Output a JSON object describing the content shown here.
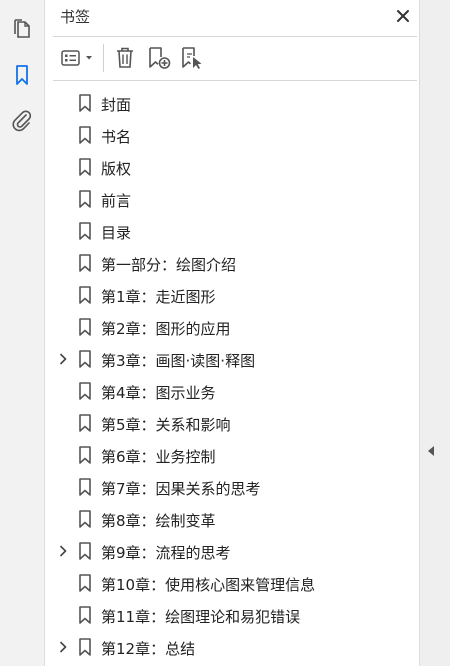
{
  "panel": {
    "title": "书签",
    "close_icon": "close-icon"
  },
  "rail": {
    "items": [
      {
        "name": "pages-icon",
        "active": false
      },
      {
        "name": "bookmark-icon",
        "active": true
      },
      {
        "name": "paperclip-icon",
        "active": false
      }
    ]
  },
  "toolbar": {
    "items": [
      "options-menu-icon",
      "delete-bookmark-icon",
      "new-bookmark-icon",
      "bookmark-from-selection-icon"
    ]
  },
  "colors": {
    "accent": "#1473e6",
    "icon": "#555555",
    "rail_bg": "#f2f2f2"
  },
  "bookmarks": [
    {
      "label": "封面",
      "expandable": false
    },
    {
      "label": "书名",
      "expandable": false
    },
    {
      "label": "版权",
      "expandable": false
    },
    {
      "label": "前言",
      "expandable": false
    },
    {
      "label": "目录",
      "expandable": false
    },
    {
      "label": "第一部分：绘图介绍",
      "expandable": false
    },
    {
      "label": "第1章：走近图形",
      "expandable": false
    },
    {
      "label": "第2章：图形的应用",
      "expandable": false
    },
    {
      "label": "第3章：画图·读图·释图",
      "expandable": true
    },
    {
      "label": "第4章：图示业务",
      "expandable": false
    },
    {
      "label": "第5章：关系和影响",
      "expandable": false
    },
    {
      "label": "第6章：业务控制",
      "expandable": false
    },
    {
      "label": "第7章：因果关系的思考",
      "expandable": false
    },
    {
      "label": "第8章：绘制变革",
      "expandable": false
    },
    {
      "label": "第9章：流程的思考",
      "expandable": true
    },
    {
      "label": "第10章：使用核心图来管理信息",
      "expandable": false
    },
    {
      "label": "第11章：绘图理论和易犯错误",
      "expandable": false
    },
    {
      "label": "第12章：总结",
      "expandable": true
    }
  ]
}
